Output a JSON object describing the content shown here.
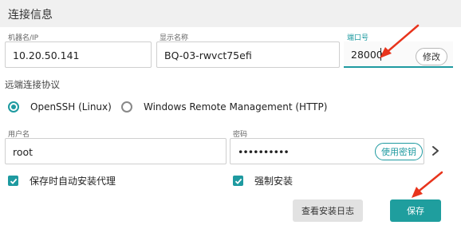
{
  "section": {
    "title": "连接信息"
  },
  "fields": {
    "machine": {
      "label": "机器名/IP",
      "value": "10.20.50.141"
    },
    "display_name": {
      "label": "显示名称",
      "value": "BQ-03-rwvct75efi"
    },
    "port": {
      "label": "端口号",
      "value": "28000",
      "edit_label": "修改"
    },
    "username": {
      "label": "用户名",
      "value": "root"
    },
    "password": {
      "label": "密码",
      "value": "••••••••••",
      "key_button_label": "使用密钥"
    }
  },
  "protocol": {
    "label": "远端连接协议",
    "options": [
      {
        "label": "OpenSSH (Linux)",
        "selected": true
      },
      {
        "label": "Windows Remote Management (HTTP)",
        "selected": false
      }
    ]
  },
  "checkboxes": {
    "auto_install": {
      "label": "保存时自动安装代理",
      "checked": true
    },
    "force_install": {
      "label": "强制安装",
      "checked": true
    }
  },
  "buttons": {
    "view_log": "查看安装日志",
    "save": "保存"
  },
  "colors": {
    "accent": "#1e9aa0",
    "annotation_arrow": "#e8341c"
  }
}
